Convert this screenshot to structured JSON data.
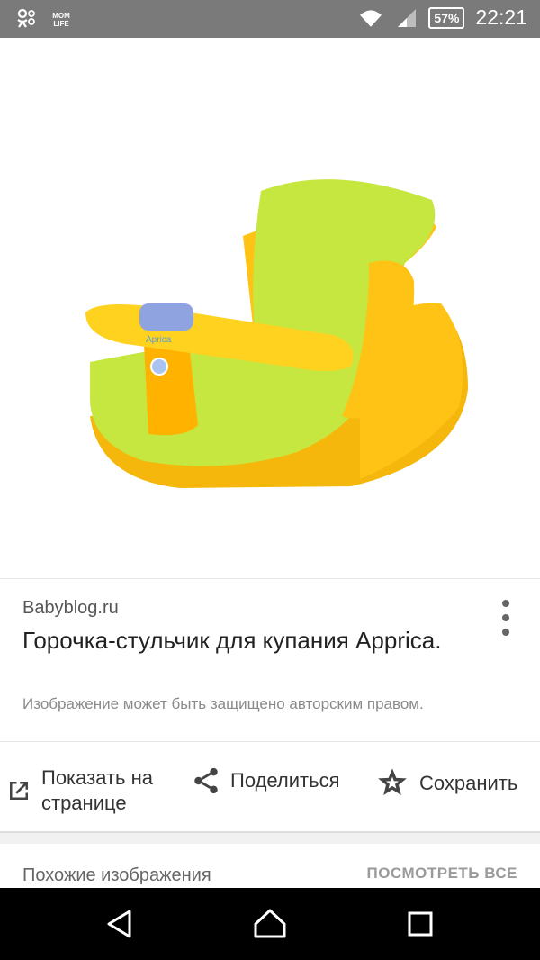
{
  "status_bar": {
    "left_icons": [
      "ok-social-icon",
      "mom-life-icon"
    ],
    "left_text": "MOM LIFE",
    "battery": "57%",
    "time": "22:21"
  },
  "image": {
    "alt": "Apprica bath seat",
    "brand_print": "Aprica"
  },
  "result": {
    "source": "Babyblog.ru",
    "title": "Горочка-стульчик для купания Apprica.",
    "copyright_notice": "Изображение может быть защищено авторским правом."
  },
  "actions": {
    "open_on_page": "Показать на странице",
    "share": "Поделиться",
    "save": "Сохранить"
  },
  "similar": {
    "label": "Похожие изображения",
    "view_all": "ПОСМОТРЕТЬ ВСЕ"
  },
  "colors": {
    "statusbar": "#7a7a7a",
    "seat_green": "#c6e640",
    "seat_yellow": "#ffc316",
    "seat_orange": "#f5b70c",
    "navbar": "#000000"
  }
}
